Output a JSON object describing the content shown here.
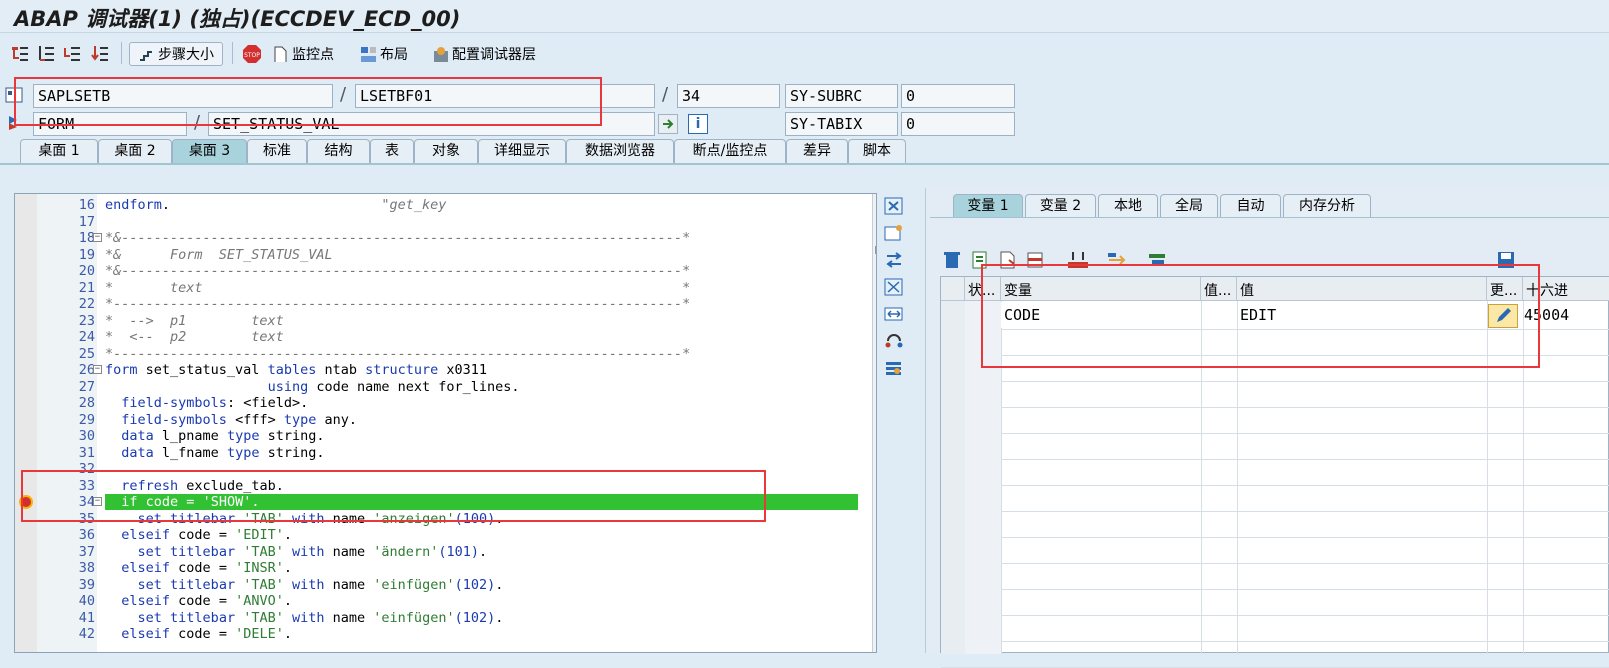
{
  "window": {
    "title": "ABAP 调试器(1) (独占)(ECCDEV_ECD_00)"
  },
  "toolbar": {
    "step_size": "步骤大小",
    "stop": "STOP",
    "watchpoint": "监控点",
    "layout": "布局",
    "config": "配置调试器层"
  },
  "header": {
    "program": "SAPLSETB",
    "include": "LSETBF01",
    "line": "34",
    "sy_subrc_label": "SY-SUBRC",
    "sy_subrc_value": "0",
    "event_type": "FORM",
    "event_name": "SET_STATUS_VAL",
    "sy_tabix_label": "SY-TABIX",
    "sy_tabix_value": "0",
    "slash": "/"
  },
  "tabs": [
    "桌面 1",
    "桌面 2",
    "桌面 3",
    "标准",
    "结构",
    "表",
    "对象",
    "详细显示",
    "数据浏览器",
    "断点/监控点",
    "差异",
    "脚本"
  ],
  "active_tab": 2,
  "code_lines": [
    {
      "n": "16",
      "t": "endform.                          \"get_key"
    },
    {
      "n": "17",
      "t": ""
    },
    {
      "n": "18",
      "t": "*&---------------------------------------------------------------------*"
    },
    {
      "n": "19",
      "t": "*&      Form  SET_STATUS_VAL"
    },
    {
      "n": "20",
      "t": "*&---------------------------------------------------------------------*"
    },
    {
      "n": "21",
      "t": "*       text                                                           *"
    },
    {
      "n": "22",
      "t": "*----------------------------------------------------------------------*"
    },
    {
      "n": "23",
      "t": "*  -->  p1        text"
    },
    {
      "n": "24",
      "t": "*  <--  p2        text"
    },
    {
      "n": "25",
      "t": "*----------------------------------------------------------------------*"
    },
    {
      "n": "26",
      "t": "form set_status_val tables ntab structure x0311"
    },
    {
      "n": "27",
      "t": "                    using code name next for_lines."
    },
    {
      "n": "28",
      "t": "  field-symbols: <field>."
    },
    {
      "n": "29",
      "t": "  field-symbols <fff> type any."
    },
    {
      "n": "30",
      "t": "  data l_pname type string."
    },
    {
      "n": "31",
      "t": "  data l_fname type string."
    },
    {
      "n": "32",
      "t": ""
    },
    {
      "n": "33",
      "t": "  refresh exclude_tab."
    },
    {
      "n": "34",
      "t": "  if code = 'SHOW'."
    },
    {
      "n": "35",
      "t": "    set titlebar 'TAB' with name 'anzeigen'(100)."
    },
    {
      "n": "36",
      "t": "  elseif code = 'EDIT'."
    },
    {
      "n": "37",
      "t": "    set titlebar 'TAB' with name 'ändern'(101)."
    },
    {
      "n": "38",
      "t": "  elseif code = 'INSR'."
    },
    {
      "n": "39",
      "t": "    set titlebar 'TAB' with name 'einfügen'(102)."
    },
    {
      "n": "40",
      "t": "  elseif code = 'ANVO'."
    },
    {
      "n": "41",
      "t": "    set titlebar 'TAB' with name 'einfügen'(102)."
    },
    {
      "n": "42",
      "t": "  elseif code = 'DELE'."
    }
  ],
  "var_tabs": [
    "变量 1",
    "变量 2",
    "本地",
    "全局",
    "自动",
    "内存分析"
  ],
  "grid": {
    "headers": [
      "状...",
      "变量",
      "值...",
      "值",
      "更...",
      "十六进"
    ],
    "rows": [
      {
        "var": "CODE",
        "val": "EDIT",
        "hex": "45004"
      }
    ]
  }
}
